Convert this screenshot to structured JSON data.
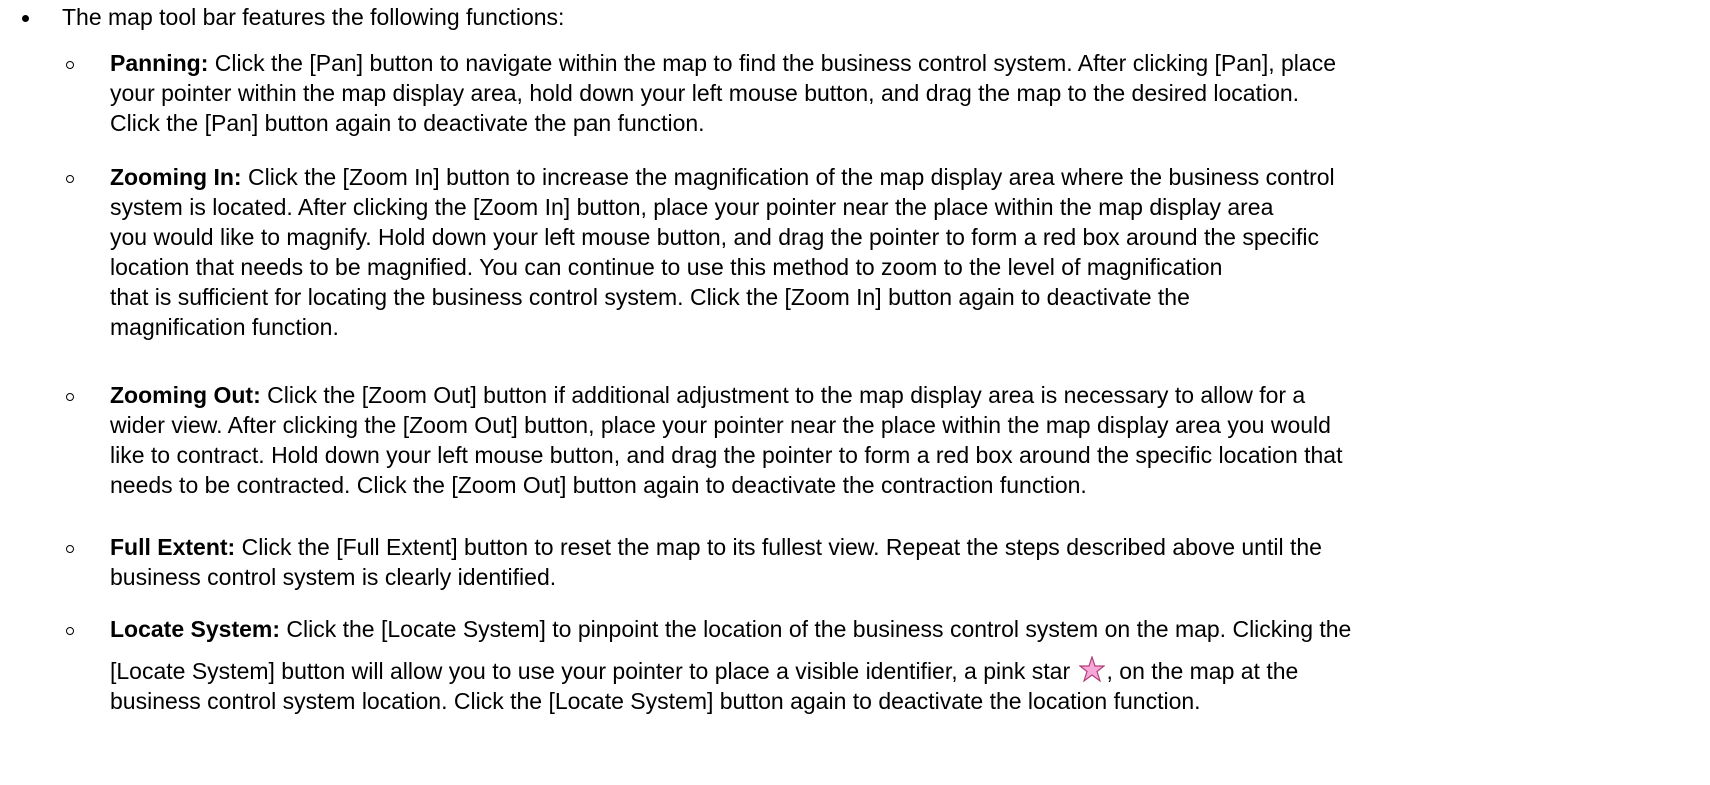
{
  "intro": "The map tool bar features the following functions:",
  "items": [
    {
      "title": "Panning:",
      "lines": [
        " Click the [Pan] button to navigate within the map to find the business control system. After clicking [Pan], place",
        "your pointer within the map display area, hold down your left mouse button, and drag the map to the desired location.",
        "Click the [Pan] button again to deactivate the pan function."
      ]
    },
    {
      "title": "Zooming In:",
      "lines": [
        " Click the [Zoom In] button to increase the magnification of the map display area where the business control",
        "system is located. After clicking the [Zoom In] button, place your pointer near the place within the map display area",
        "you would like to magnify. Hold down your left mouse button, and drag the pointer to form a red box around the specific",
        "location that needs to be magnified. You can continue to use this method to zoom to the level of magnification",
        "that is sufficient for locating the business control system. Click the [Zoom In] button again to deactivate the",
        "magnification function."
      ]
    },
    {
      "title": "Zooming Out:",
      "lines": [
        " Click the [Zoom Out] button if additional adjustment to the map display area is necessary to allow for a",
        "wider view. After clicking the [Zoom Out] button, place your pointer near the place within the map display area you would",
        "like to contract. Hold down your left mouse button, and drag the pointer to form a red box around the specific location that",
        "needs to be contracted. Click the [Zoom Out] button again to deactivate the contraction function."
      ]
    },
    {
      "title": "Full Extent:",
      "lines": [
        " Click the [Full Extent] button to reset the map to its fullest view. Repeat the steps described above until the",
        "business control system is clearly identified."
      ]
    },
    {
      "title": "Locate System:",
      "lines": [
        " Click the [Locate System] to pinpoint the location of the business control system on the map. Clicking the"
      ],
      "star_line_before": "[Locate System] button will allow you to use your pointer to place a visible identifier, a pink star",
      "star_line_after": ", on the map at the",
      "last_line": "business control system location. Click the [Locate System] button again to deactivate the location function."
    }
  ],
  "colors": {
    "star_fill": "#f7a8d8",
    "star_stroke": "#b0407a"
  },
  "icons": {
    "star": "pink-star-icon"
  }
}
